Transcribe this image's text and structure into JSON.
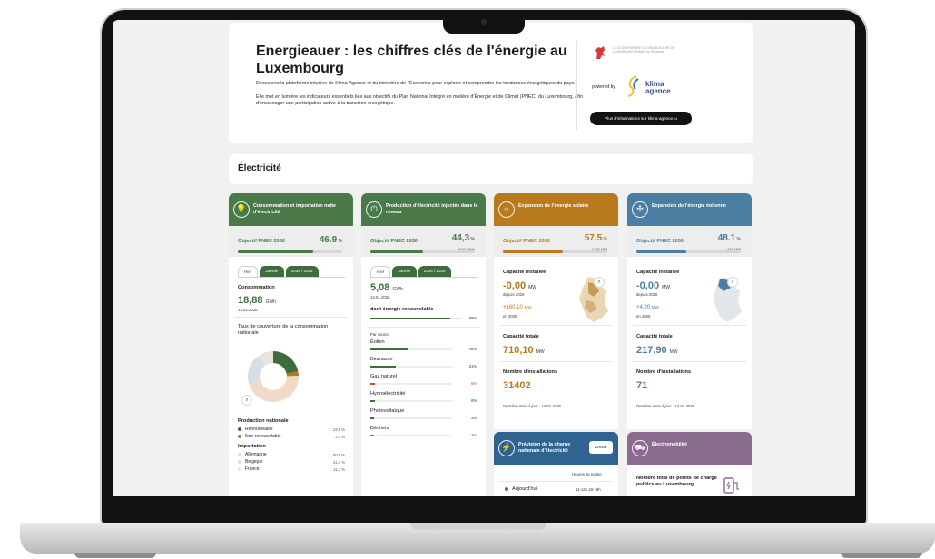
{
  "header": {
    "title": "Energieauer : les chiffres clés de l'énergie au Luxembourg",
    "intro_1": "Découvrez la plateforme intuitive de Klima-Agence et du ministère de l'Économie pour explorer et comprendre les tendances énergétiques du pays.",
    "intro_2": "Elle met en lumière les indicateurs essentiels liés aux objectifs du Plan National Intégré en matière d'Énergie et de Climat (PNEC) du Luxembourg, afin d'encourager une participation active à la transition énergétique.",
    "gov_text": "LE GOUVERNEMENT DU GRAND-DUCHÉ DE LUXEMBOURG Ministère de l'Économie",
    "powered_by": "powered by",
    "klima_logo": "klima agence",
    "info_button": "Plus d'informations sur klima-agence.lu"
  },
  "section_title": "Électricité",
  "colors": {
    "green": "#4a7a49",
    "green_dark": "#3f6b3e",
    "orange": "#b97a1d",
    "blue": "#4a7fa3",
    "purple": "#8c6b91",
    "red": "#d04b2a"
  },
  "card1": {
    "icon": "bulb-icon",
    "title": "Consommation et importation nette d'électricité",
    "pnec_label": "Objectif PNEC 2030",
    "pnec_value": "46.9",
    "pnec_fill": 0.72,
    "tabs": [
      "Hier",
      "Janvier",
      "2026 / 2025"
    ],
    "consumption_label": "Consommation",
    "consumption_value": "18,88",
    "consumption_unit": "GWh",
    "date": "13.01.2026",
    "coverage_label": "Taux de couverture de la consommation nationale",
    "production_title": "Production nationale",
    "production": [
      {
        "label": "Renouvelable",
        "value": "23.8 %",
        "color": "#3f6b3e"
      },
      {
        "label": "Non-renouvelable",
        "value": "3.1 %",
        "color": "#b97a1d"
      }
    ],
    "import_title": "Importation",
    "imports": [
      {
        "label": "Allemagne",
        "value": "50.6 %",
        "color": "#f0d9c6"
      },
      {
        "label": "Belgique",
        "value": "21.1 %",
        "color": "#d6dde6"
      },
      {
        "label": "France",
        "value": "11.3 %",
        "color": "#e9e4dc"
      }
    ],
    "donut": [
      23.8,
      3.1,
      50.6,
      21.1,
      11.3
    ]
  },
  "card2": {
    "icon": "power-plug-icon",
    "title": "Production d'électricité injectée dans le réseau",
    "pnec_label": "Objectif PNEC 2030",
    "pnec_value": "44,3",
    "pnec_sub": "3032 GWh",
    "pnec_fill": 0.5,
    "tabs": [
      "Hier",
      "Janvier",
      "2026 / 2025"
    ],
    "prod_value": "5,08",
    "prod_unit": "GWh",
    "date": "13.01.2026",
    "renew_label": "dont énergie renouvelable",
    "renew_pct": "88%",
    "renew_fill": 0.88,
    "by_source": "Par source",
    "sources": [
      {
        "label": "Éolien",
        "value": "46%",
        "fill": 0.46,
        "color": "#3f6b3e"
      },
      {
        "label": "Biomasse",
        "value": "31%",
        "fill": 0.31,
        "color": "#3f6b3e"
      },
      {
        "label": "Gaz naturel",
        "value": "6%",
        "fill": 0.06,
        "color": "#d04b2a"
      },
      {
        "label": "Hydroélectricité",
        "value": "6%",
        "fill": 0.06,
        "color": "#3f6b3e"
      },
      {
        "label": "Photovoltaïque",
        "value": "3%",
        "fill": 0.03,
        "color": "#3f6b3e"
      },
      {
        "label": "Déchets",
        "value": "3%",
        "fill": 0.03,
        "color": "#d04b2a"
      }
    ]
  },
  "card3": {
    "icon": "sun-icon",
    "title": "Expansion de l'énergie solaire",
    "pnec_label": "Objectif PNEC 2030",
    "pnec_value": "57.5",
    "pnec_sub": "1236 MW",
    "pnec_fill": 0.57,
    "installed_label": "Capacité installée",
    "installed_value": "-0,00",
    "unit": "MW",
    "since": "depuis 2026",
    "delta_value": "+160,10",
    "delta_unit": "MW",
    "delta_when": "en 2025",
    "total_label": "Capacité totale",
    "total_value": "710,10",
    "count_label": "Nombre d'installations",
    "count_value": "31402",
    "updated": "Dernière mise à jour : 14.01.2026"
  },
  "card4": {
    "icon": "wind-turbine-icon",
    "title": "Expansion de l'énergie éolienne",
    "pnec_label": "Objectif PNEC 2030",
    "pnec_value": "48.1",
    "pnec_sub": "433 MW",
    "pnec_fill": 0.48,
    "installed_label": "Capacité installée",
    "installed_value": "-0,00",
    "unit": "MW",
    "since": "depuis 2026",
    "delta_value": "+4,20",
    "delta_unit": "MW",
    "delta_when": "en 2025",
    "total_label": "Capacité totale",
    "total_value": "217,90",
    "count_label": "Nombre d'installations",
    "count_value": "71",
    "updated": "Dernière mise à jour : 14.01.2026"
  },
  "card5": {
    "icon": "grid-load-icon",
    "title": "Prévision de la charge nationale d'électricité",
    "badge": "creos",
    "col_header": "Heures de pointe",
    "row_label": "Aujourd'hui",
    "row_value": "11-12h 18-19h"
  },
  "card6": {
    "icon": "ev-icon",
    "title": "Électromobilité",
    "label": "Nombre total de points de charge publics au Luxembourg",
    "charger_icon": "ev-charger-icon"
  }
}
